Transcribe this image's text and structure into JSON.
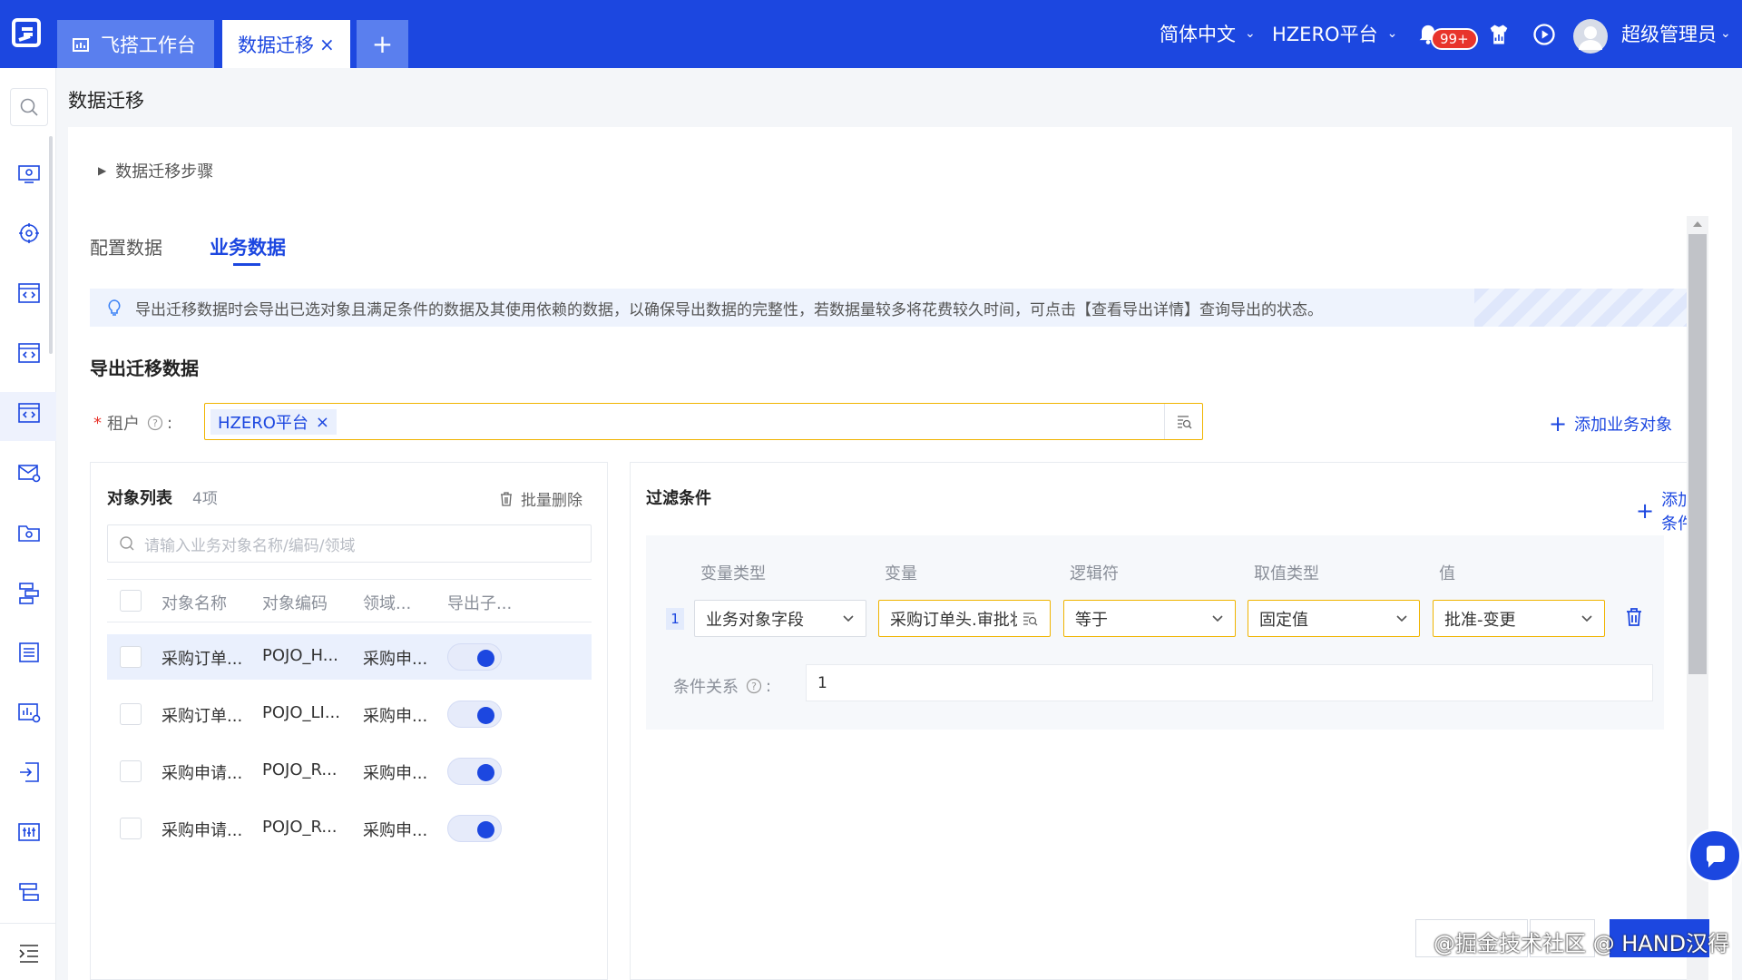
{
  "header": {
    "tabs": [
      {
        "label": "飞搭工作台"
      },
      {
        "label": "数据迁移"
      },
      {
        "label": "+"
      }
    ],
    "language": "简体中文",
    "platform": "HZERO平台",
    "notification_badge": "99+",
    "user_name": "超级管理员"
  },
  "breadcrumb": "数据迁移",
  "steps_toggle": "数据迁移步骤",
  "content_tabs": [
    {
      "label": "配置数据",
      "active": false
    },
    {
      "label": "业务数据",
      "active": true
    }
  ],
  "alert_text": "导出迁移数据时会导出已选对象且满足条件的数据及其使用依赖的数据，以确保导出数据的完整性，若数据量较多将花费较久时间，可点击【查看导出详情】查询导出的状态。",
  "section_title": "导出迁移数据",
  "tenant": {
    "required_mark": "*",
    "label": "租户",
    "colon": ":",
    "tag": "HZERO平台"
  },
  "add_business_object": "添加业务对象",
  "object_list": {
    "title": "对象列表",
    "count": "4项",
    "batch_delete": "批量删除",
    "search_placeholder": "请输入业务对象名称/编码/领域",
    "columns": [
      "对象名称",
      "对象编码",
      "领域...",
      "导出子..."
    ],
    "rows": [
      {
        "name": "采购订单...",
        "code": "POJO_H...",
        "domain": "采购申...",
        "export_sub": true,
        "selected": true
      },
      {
        "name": "采购订单...",
        "code": "POJO_LI...",
        "domain": "采购申...",
        "export_sub": true,
        "selected": false
      },
      {
        "name": "采购申请...",
        "code": "POJO_R...",
        "domain": "采购申...",
        "export_sub": true,
        "selected": false
      },
      {
        "name": "采购申请...",
        "code": "POJO_R...",
        "domain": "采购申...",
        "export_sub": true,
        "selected": false
      }
    ]
  },
  "filter": {
    "title": "过滤条件",
    "add_condition": "添加条件",
    "columns": [
      "变量类型",
      "变量",
      "逻辑符",
      "取值类型",
      "值"
    ],
    "row": {
      "index": "1",
      "variable_type": "业务对象字段",
      "variable": "采购订单头.审批状",
      "operator": "等于",
      "value_type": "固定值",
      "value": "批准-变更"
    },
    "relation_label": "条件关系",
    "relation_colon": ":",
    "relation_value": "1"
  },
  "footer": {
    "watermark": "@掘金技术社区 @ HAND汉得"
  },
  "colors": {
    "primary": "#1c47e0",
    "header_bg": "#1c47e0",
    "badge": "#e8342b",
    "focus_border": "#f0b400"
  }
}
